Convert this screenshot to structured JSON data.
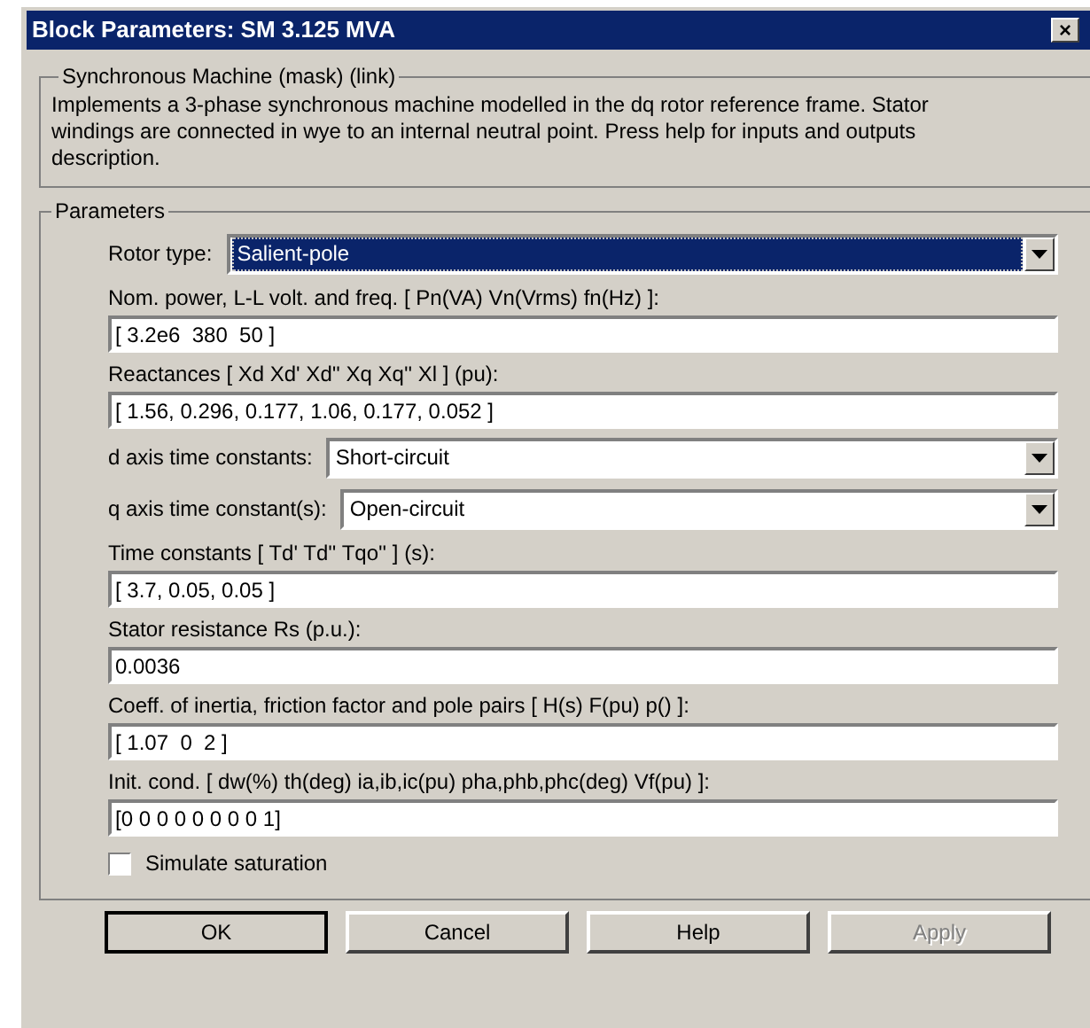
{
  "window": {
    "title": "Block Parameters: SM 3.125 MVA",
    "close": "×"
  },
  "description": {
    "title": "Synchronous Machine (mask) (link)",
    "text": "Implements a 3-phase synchronous machine modelled in the dq rotor reference frame. Stator windings are connected in wye to an internal neutral point. Press help for inputs and outputs description."
  },
  "parameters": {
    "title": "Parameters",
    "items": [
      {
        "kind": "dropdown",
        "label": "Rotor type:",
        "value": "Salient-pole",
        "selected": true
      },
      {
        "kind": "text",
        "label": "Nom. power, L-L volt. and freq. [ Pn(VA)  Vn(Vrms)  fn(Hz) ]:",
        "value": "[ 3.2e6  380  50 ]"
      },
      {
        "kind": "text",
        "label": "Reactances [ Xd Xd' Xd'' Xq Xq'' Xl ] (pu):",
        "value": "[ 1.56, 0.296, 0.177, 1.06, 0.177, 0.052 ]"
      },
      {
        "kind": "dropdown",
        "label": "d axis time constants:",
        "value": "Short-circuit",
        "selected": false
      },
      {
        "kind": "dropdown",
        "label": "q axis time constant(s):",
        "value": "Open-circuit",
        "selected": false
      },
      {
        "kind": "text",
        "label": "Time constants [ Td'  Td''  Tqo'' ] (s):",
        "value": "[ 3.7, 0.05, 0.05 ]"
      },
      {
        "kind": "text",
        "label": "Stator resistance Rs (p.u.):",
        "value": "0.0036"
      },
      {
        "kind": "text",
        "label": "Coeff. of inertia, friction factor and pole pairs [ H(s)  F(pu)  p() ]:",
        "value": "[ 1.07  0  2 ]"
      },
      {
        "kind": "text",
        "label": "Init. cond. [ dw(%)  th(deg)  ia,ib,ic(pu)  pha,phb,phc(deg)  Vf(pu) ]:",
        "value": "[0 0 0 0 0 0 0 0 1]"
      },
      {
        "kind": "checkbox",
        "label": "Simulate saturation",
        "checked": false
      }
    ]
  },
  "buttons": [
    {
      "label": "OK",
      "default": true,
      "disabled": false
    },
    {
      "label": "Cancel",
      "default": false,
      "disabled": false
    },
    {
      "label": "Help",
      "default": false,
      "disabled": false
    },
    {
      "label": "Apply",
      "default": false,
      "disabled": true
    }
  ]
}
